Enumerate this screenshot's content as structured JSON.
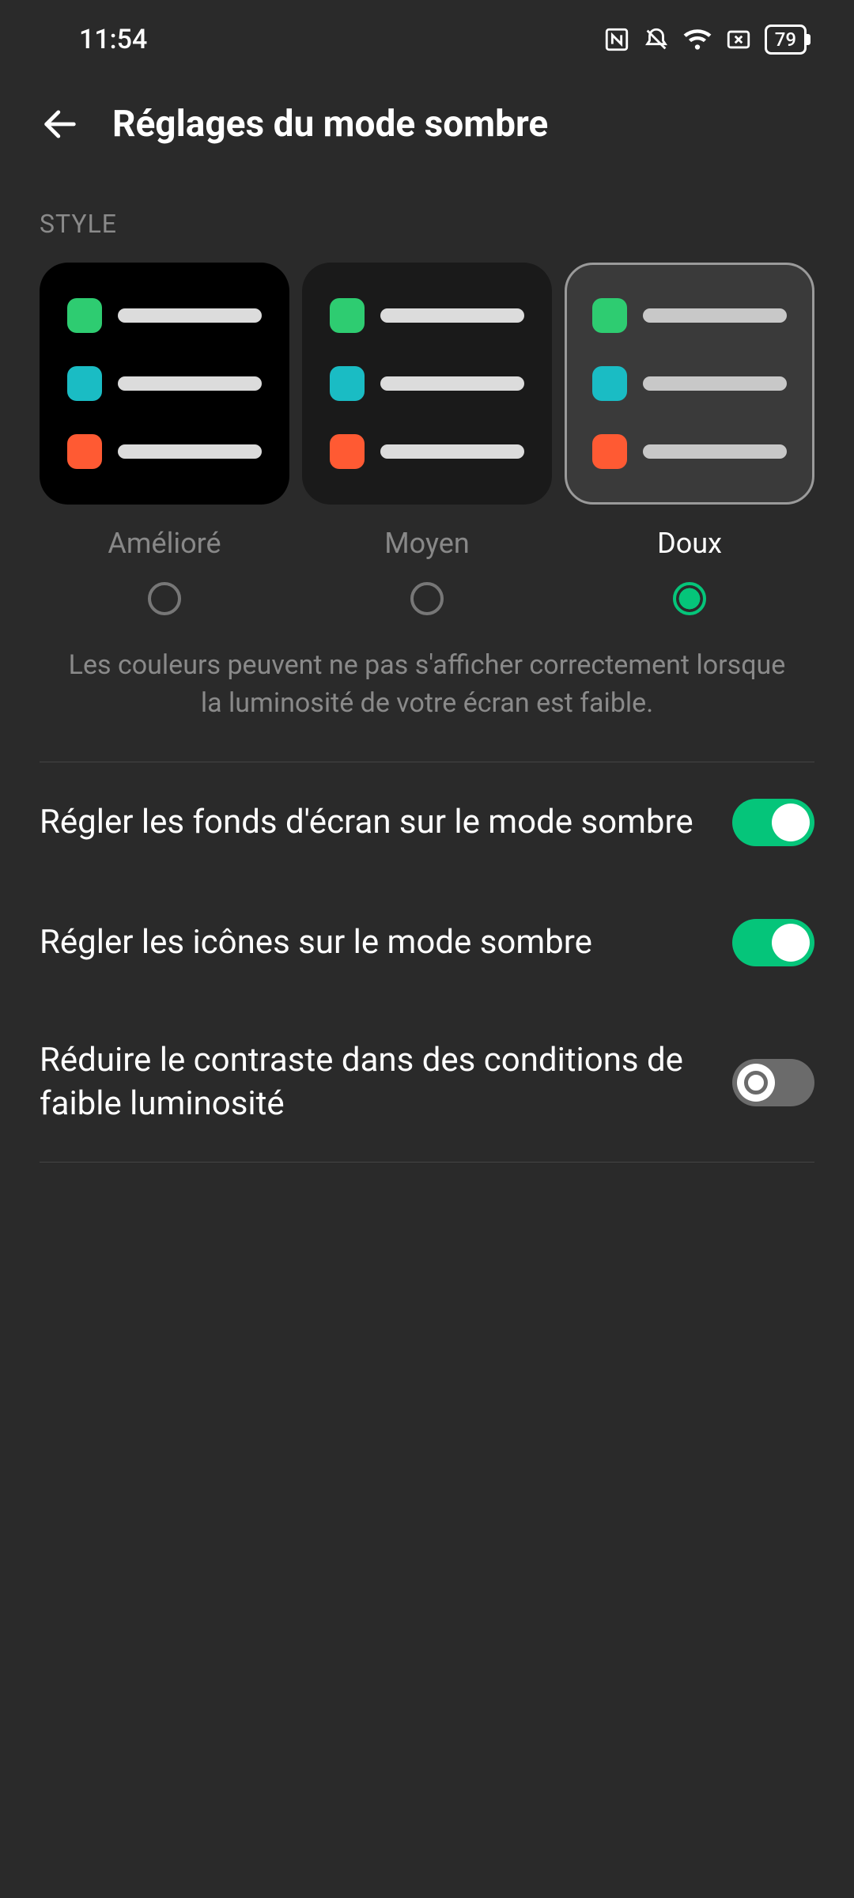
{
  "status": {
    "time": "11:54",
    "battery_pct": "79"
  },
  "header": {
    "title": "Réglages du mode sombre"
  },
  "style_section": {
    "label": "STYLE",
    "options": [
      {
        "label": "Amélioré",
        "selected": false
      },
      {
        "label": "Moyen",
        "selected": false
      },
      {
        "label": "Doux",
        "selected": true
      }
    ],
    "hint": "Les couleurs peuvent ne pas s'afficher correctement lorsque la luminosité de votre écran est faible."
  },
  "settings": [
    {
      "label": "Régler les fonds d'écran sur le mode sombre",
      "on": true
    },
    {
      "label": "Régler les icônes sur le mode sombre",
      "on": true
    },
    {
      "label": "Réduire le contraste dans des conditions de faible luminosité",
      "on": false
    }
  ],
  "colors": {
    "accent": "#05c57a"
  }
}
